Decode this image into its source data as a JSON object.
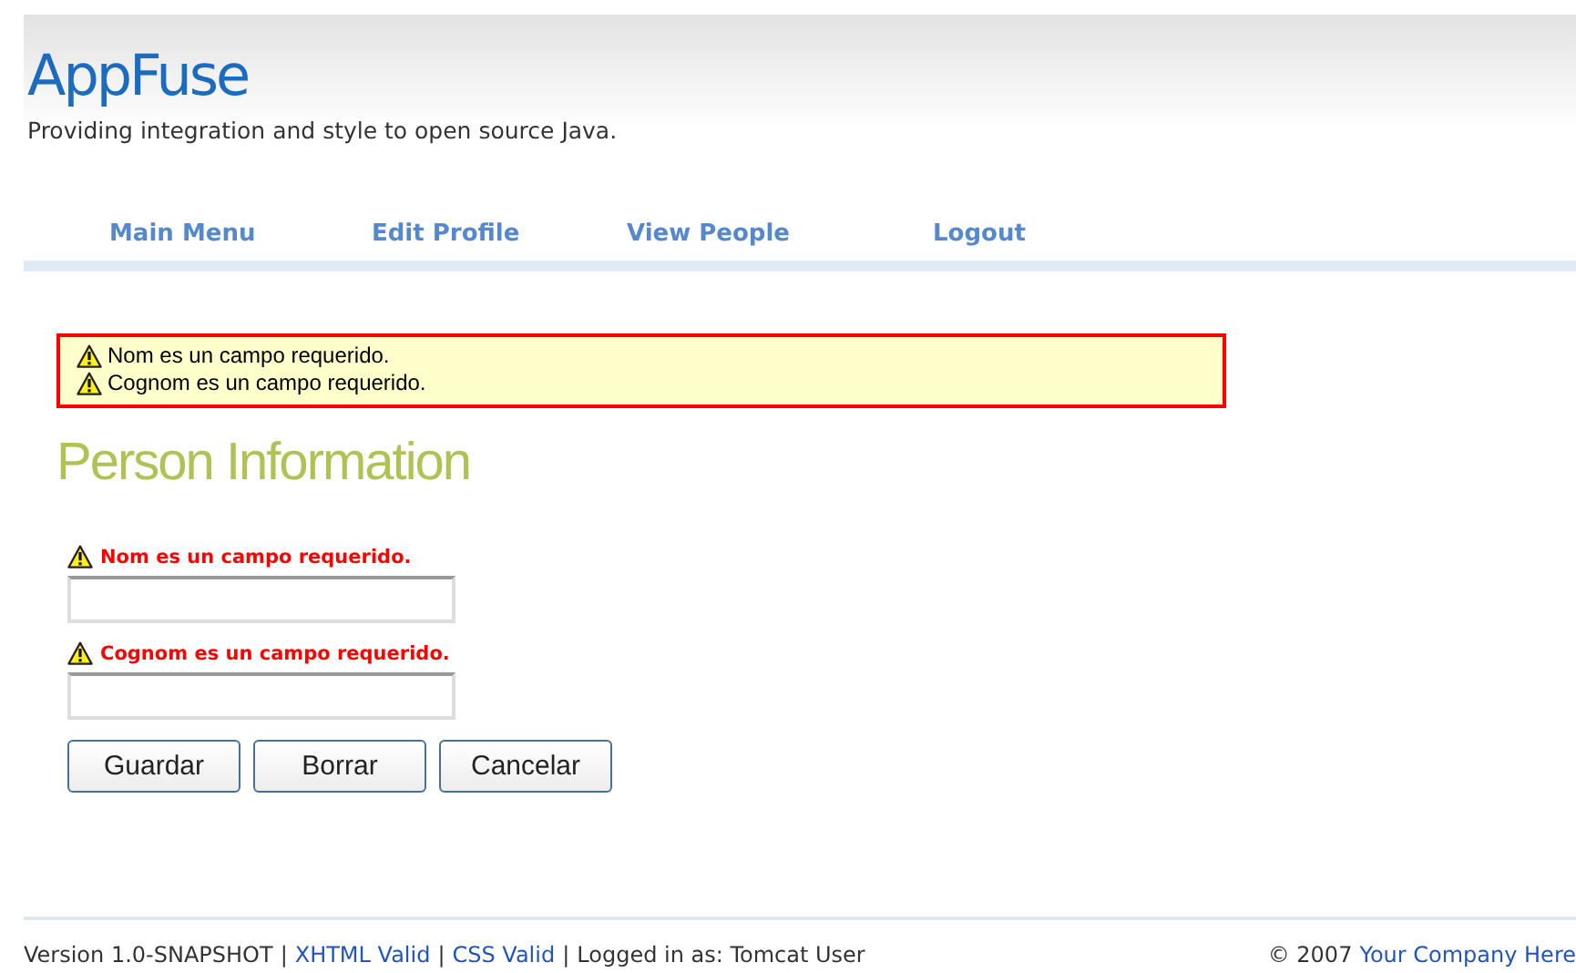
{
  "header": {
    "logo": "AppFuse",
    "tagline": "Providing integration and style to open source Java."
  },
  "nav": [
    "Main Menu",
    "Edit Profile",
    "View People",
    "Logout"
  ],
  "errors": [
    "Nom es un campo requerido.",
    "Cognom es un campo requerido."
  ],
  "heading": "Person Information",
  "fields": [
    {
      "error": "Nom es un campo requerido."
    },
    {
      "error": "Cognom es un campo requerido."
    }
  ],
  "buttons": [
    "Guardar",
    "Borrar",
    "Cancelar"
  ],
  "footer": {
    "version": "Version 1.0-SNAPSHOT",
    "separator": "|",
    "links": [
      "XHTML Valid",
      "CSS Valid"
    ],
    "user": "Logged in as: Tomcat User",
    "copyright": "© 2007",
    "company": "Your Company Here"
  }
}
